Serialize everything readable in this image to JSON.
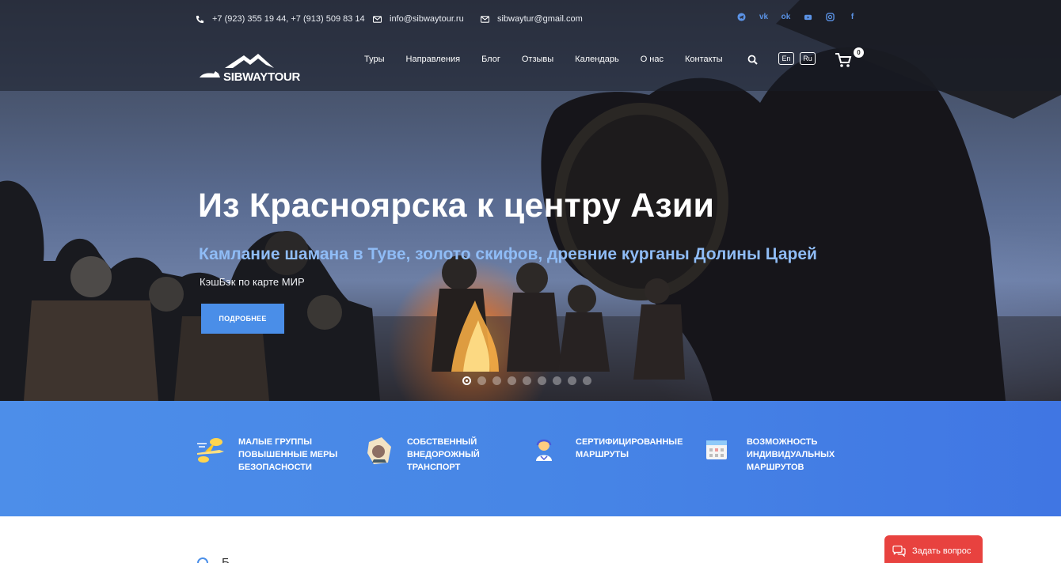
{
  "topbar": {
    "phones": "+7 (923) 355 19 44, +7 (913) 509 83 14",
    "email1": "info@sibwaytour.ru",
    "email2": "sibwaytur@gmail.com",
    "social_icons": [
      "telegram-icon",
      "vk-icon",
      "odnoklassniki-icon",
      "youtube-icon",
      "instagram-icon",
      "facebook-icon"
    ]
  },
  "logo": {
    "text": "SIBWAYTOUR"
  },
  "nav": {
    "items": [
      {
        "label": "Туры"
      },
      {
        "label": "Направления"
      },
      {
        "label": "Блог"
      },
      {
        "label": "Отзывы"
      },
      {
        "label": "Календарь"
      },
      {
        "label": "О нас"
      },
      {
        "label": "Контакты"
      }
    ],
    "lang_en": "En",
    "lang_ru": "Ru",
    "cart_count": "0"
  },
  "hero": {
    "title": "Из Красноярска к центру Азии",
    "subtitle": "Камлание шамана в Туве, золото скифов, древние курганы Долины Царей",
    "note": "КэшБэк по карте МИР",
    "button": "ПОДРОБНЕЕ",
    "slides_total": 9,
    "active_slide": 1
  },
  "features": [
    {
      "icon": "plane-icon",
      "text": "Малые группы повышенные меры безопасности"
    },
    {
      "icon": "offroad-vehicle-icon",
      "text": "Собственный внедорожный транспорт"
    },
    {
      "icon": "certified-guide-icon",
      "text": "Сертифицированные маршруты"
    },
    {
      "icon": "calendar-icon",
      "text": "Возможность индивидуальных маршрутов"
    }
  ],
  "below": {
    "text": "Б"
  },
  "ask_button": {
    "label": "Задать вопрос"
  },
  "colors": {
    "accent": "#4a8ee8",
    "subtitle": "#8fbcf6",
    "ask": "#e8423f"
  }
}
